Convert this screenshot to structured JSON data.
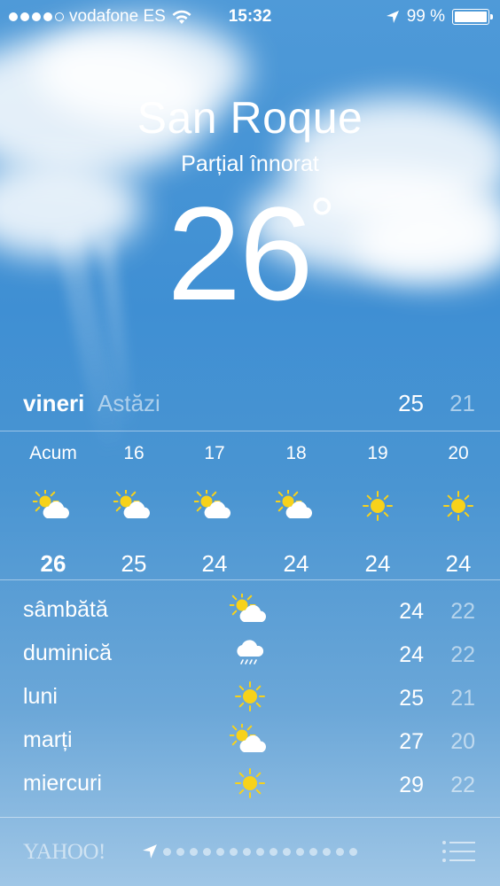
{
  "status_bar": {
    "carrier": "vodafone ES",
    "signal_filled": 4,
    "signal_total": 5,
    "time": "15:32",
    "battery": "99 %"
  },
  "location": {
    "city": "San Roque",
    "condition": "Parțial înnorat",
    "temperature": "26",
    "degree": "°"
  },
  "today": {
    "day": "vineri",
    "label": "Astăzi",
    "high": "25",
    "low": "21"
  },
  "hourly": [
    {
      "hour": "Acum",
      "icon": "partly-cloudy-icon",
      "temp": "26"
    },
    {
      "hour": "16",
      "icon": "partly-cloudy-icon",
      "temp": "25"
    },
    {
      "hour": "17",
      "icon": "partly-cloudy-icon",
      "temp": "24"
    },
    {
      "hour": "18",
      "icon": "partly-cloudy-icon",
      "temp": "24"
    },
    {
      "hour": "19",
      "icon": "sun-icon",
      "temp": "24"
    },
    {
      "hour": "20",
      "icon": "sun-icon",
      "temp": "24"
    }
  ],
  "daily": [
    {
      "day": "sâmbătă",
      "icon": "partly-cloudy-icon",
      "high": "24",
      "low": "22"
    },
    {
      "day": "duminică",
      "icon": "rain-cloud-icon",
      "high": "24",
      "low": "22"
    },
    {
      "day": "luni",
      "icon": "sun-icon",
      "high": "25",
      "low": "21"
    },
    {
      "day": "marți",
      "icon": "partly-cloudy-icon",
      "high": "27",
      "low": "20"
    },
    {
      "day": "miercuri",
      "icon": "sun-icon",
      "high": "29",
      "low": "22"
    }
  ],
  "footer": {
    "provider": "YAHOO!",
    "page_count": 15,
    "current_page": 0
  },
  "colors": {
    "sun": "#f7d21b",
    "secondary_text": "rgba(255,255,255,0.55)"
  }
}
